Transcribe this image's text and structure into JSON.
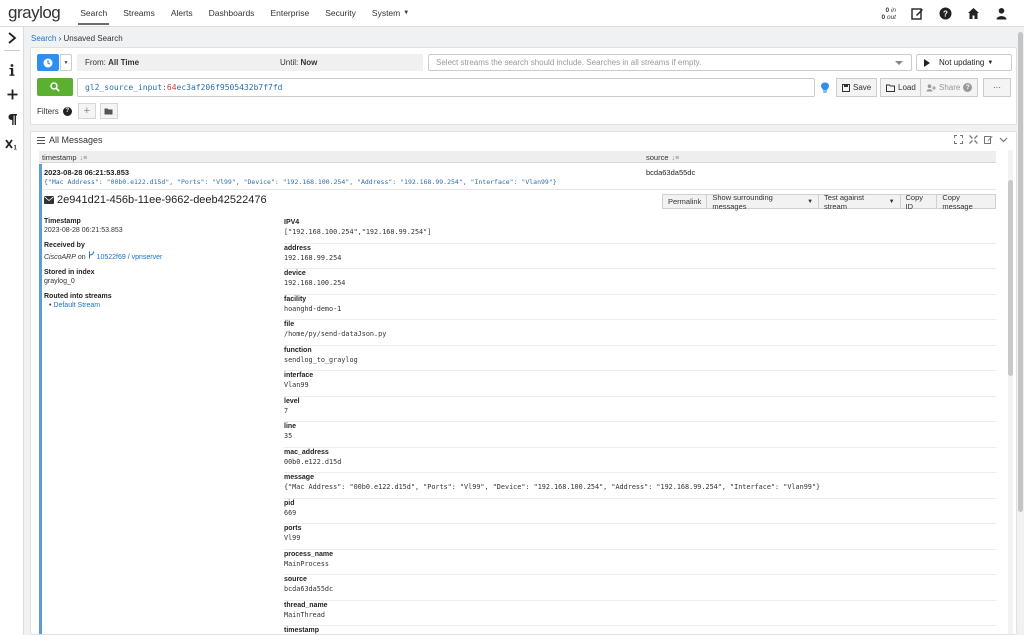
{
  "nav": {
    "logo_text": "graylog",
    "items": [
      {
        "label": "Search",
        "active": true
      },
      {
        "label": "Streams"
      },
      {
        "label": "Alerts"
      },
      {
        "label": "Dashboards"
      },
      {
        "label": "Enterprise"
      },
      {
        "label": "Security"
      },
      {
        "label": "System"
      }
    ],
    "throughput": {
      "in_value": "0",
      "in_label": "in",
      "out_value": "0",
      "out_label": "out"
    }
  },
  "breadcrumb": {
    "search": "Search",
    "separator": "›",
    "current": "Unsaved Search"
  },
  "query": {
    "from_label": "From:",
    "from_value": "All Time",
    "until_label": "Until:",
    "until_value": "Now",
    "streams_placeholder": "Select streams the search should include. Searches in all streams if empty.",
    "updating_label": "Not updating",
    "query_key": "gl2_source_input:",
    "query_value_hl": "64",
    "query_value_rest": "ec3af206f9505432b7f7fd",
    "save_label": "Save",
    "load_label": "Load",
    "share_label": "Share",
    "more_label": "···",
    "filters_label": "Filters"
  },
  "messages": {
    "title": "All Messages",
    "col_timestamp": "timestamp",
    "col_source": "source",
    "row": {
      "timestamp": "2023-08-28 06:21:53.853",
      "message": "{\"Mac Address\": \"00b0.e122.d15d\", \"Ports\": \"Vl99\", \"Device\": \"192.168.100.254\", \"Address\": \"192.168.99.254\", \"Interface\": \"Vlan99\"}",
      "source": "bcda63da55dc"
    },
    "detail": {
      "id": "2e941d21-456b-11ee-9662-deeb42522476",
      "actions": [
        "Permalink",
        "Show surrounding messages",
        "Test against stream",
        "Copy ID",
        "Copy message"
      ],
      "timestamp_label": "Timestamp",
      "timestamp_value": "2023-08-28 06:21:53.853",
      "received_label": "Received by",
      "received_by": "CiscoARP",
      "received_on": "on",
      "received_node": "10522f69 / vpnserver",
      "index_label": "Stored in index",
      "index_value": "graylog_0",
      "streams_label": "Routed into streams",
      "streams": [
        "Default Stream"
      ],
      "fields": [
        {
          "name": "IPV4",
          "value": "[\"192.168.100.254\",\"192.168.99.254\"]"
        },
        {
          "name": "address",
          "value": "192.168.99.254"
        },
        {
          "name": "device",
          "value": "192.168.100.254"
        },
        {
          "name": "facility",
          "value": "hoanghd-demo-1"
        },
        {
          "name": "file",
          "value": "/home/py/send-dataJson.py"
        },
        {
          "name": "function",
          "value": "sendlog_to_graylog"
        },
        {
          "name": "interface",
          "value": "Vlan99"
        },
        {
          "name": "level",
          "value": "7"
        },
        {
          "name": "line",
          "value": "35"
        },
        {
          "name": "mac_address",
          "value": "00b0.e122.d15d"
        },
        {
          "name": "message",
          "value": "{\"Mac Address\": \"00b0.e122.d15d\", \"Ports\": \"Vl99\", \"Device\": \"192.168.100.254\", \"Address\": \"192.168.99.254\", \"Interface\": \"Vlan99\"}"
        },
        {
          "name": "pid",
          "value": "669"
        },
        {
          "name": "ports",
          "value": "Vl99"
        },
        {
          "name": "process_name",
          "value": "MainProcess"
        },
        {
          "name": "source",
          "value": "bcda63da55dc"
        },
        {
          "name": "thread_name",
          "value": "MainThread"
        },
        {
          "name": "timestamp",
          "value": ""
        }
      ]
    }
  },
  "colors": {
    "accent_blue": "#2f8ef0",
    "search_green": "#5cb030",
    "logo_red": "#ff3633",
    "row_marker": "#5a9fd4"
  }
}
